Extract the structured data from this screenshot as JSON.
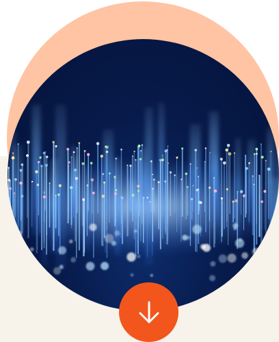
{
  "colors": {
    "background": "#ffffff",
    "beige_band": "#f7f2ea",
    "peach_circle": "#ffc4a3",
    "hero_dark": "#04133a",
    "accent_orange": "#f2561d",
    "icon_white": "#ffffff"
  },
  "hero": {
    "image": "abstract-digital-data-sound-wave"
  },
  "download_button": {
    "icon": "arrow-down-icon"
  }
}
